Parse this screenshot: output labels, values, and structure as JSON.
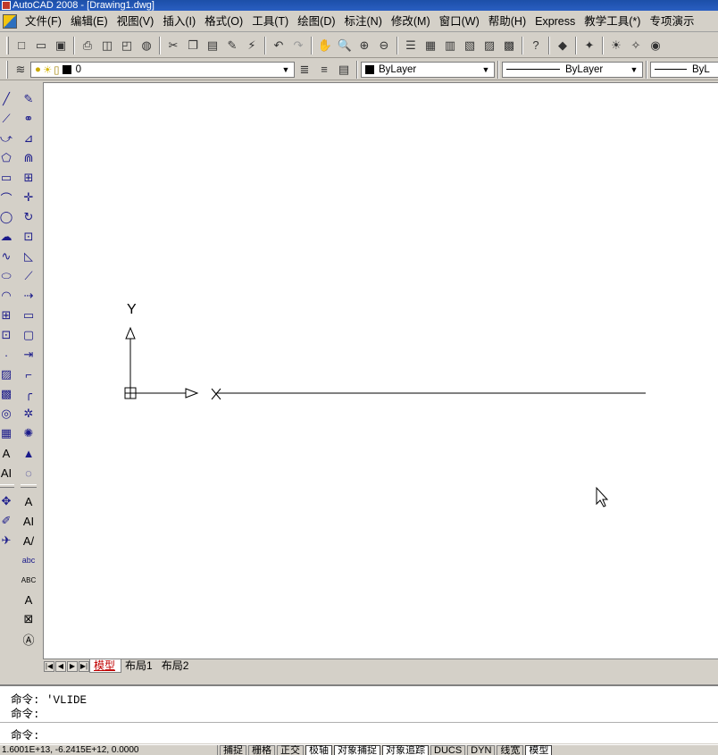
{
  "window": {
    "title": "AutoCAD 2008 - [Drawing1.dwg]"
  },
  "menubar": {
    "items": [
      "文件(F)",
      "编辑(E)",
      "视图(V)",
      "插入(I)",
      "格式(O)",
      "工具(T)",
      "绘图(D)",
      "标注(N)",
      "修改(M)",
      "窗口(W)",
      "帮助(H)",
      "Express",
      "教学工具(*)",
      "专项演示"
    ]
  },
  "layers": {
    "current_layer": "0"
  },
  "properties": {
    "color": "ByLayer",
    "linetype": "ByLayer",
    "lineweight": "ByL"
  },
  "layout_tabs": {
    "tabs": [
      "模型",
      "布局1",
      "布局2"
    ],
    "active": "模型"
  },
  "ucs": {
    "y_label": "Y"
  },
  "command": {
    "history": [
      "命令: 'VLIDE",
      "命令:"
    ],
    "prompt": "命令:"
  },
  "status": {
    "coordinates": "1.6001E+13, -6.2415E+12, 0.0000",
    "toggles": [
      "捕捉",
      "栅格",
      "正交",
      "极轴",
      "对象捕捉",
      "对象追踪",
      "DUCS",
      "DYN",
      "线宽",
      "模型"
    ],
    "on": [
      "极轴",
      "对象捕捉",
      "对象追踪",
      "模型"
    ]
  },
  "colors": {
    "title_bar": "#1c4fa8",
    "active_tab_text": "#c00000",
    "canvas": "#ffffff"
  },
  "icons": {
    "standard": [
      "new-icon",
      "open-icon",
      "save-icon",
      "print-icon",
      "preview-icon",
      "publish-icon",
      "3d-dwf-icon",
      "cut-icon",
      "copy-icon",
      "paste-icon",
      "match-properties-icon",
      "block-editor-icon",
      "undo-icon",
      "redo-icon",
      "pan-icon",
      "zoom-realtime-icon",
      "zoom-window-icon",
      "zoom-previous-icon",
      "properties-icon",
      "design-center-icon",
      "tool-palettes-icon",
      "sheet-set-icon",
      "markup-icon",
      "quickcalc-icon",
      "help-icon",
      "3d-orbit-icon",
      "render-icon",
      "sun-icon",
      "light-icon",
      "camera-icon"
    ],
    "draw": [
      "line-icon",
      "xline-icon",
      "polyline-icon",
      "polygon-icon",
      "rectangle-icon",
      "arc-icon",
      "circle-icon",
      "revcloud-icon",
      "spline-icon",
      "ellipse-icon",
      "ellipse-arc-icon",
      "insert-block-icon",
      "make-block-icon",
      "point-icon",
      "hatch-icon",
      "gradient-icon",
      "region-icon",
      "table-icon",
      "mtext-icon"
    ],
    "modify": [
      "erase-icon",
      "copy-object-icon",
      "mirror-icon",
      "offset-icon",
      "array-icon",
      "move-icon",
      "rotate-icon",
      "scale-icon",
      "stretch-icon",
      "trim-icon",
      "extend-icon",
      "break-at-point-icon",
      "break-icon",
      "join-icon",
      "chamfer-icon",
      "fillet-icon",
      "explode-icon"
    ],
    "text": [
      "text-icon",
      "mtext-edit-icon",
      "edit-text-icon",
      "find-icon",
      "spell-check-icon",
      "text-style-icon",
      "scale-text-icon",
      "justify-text-icon"
    ]
  }
}
